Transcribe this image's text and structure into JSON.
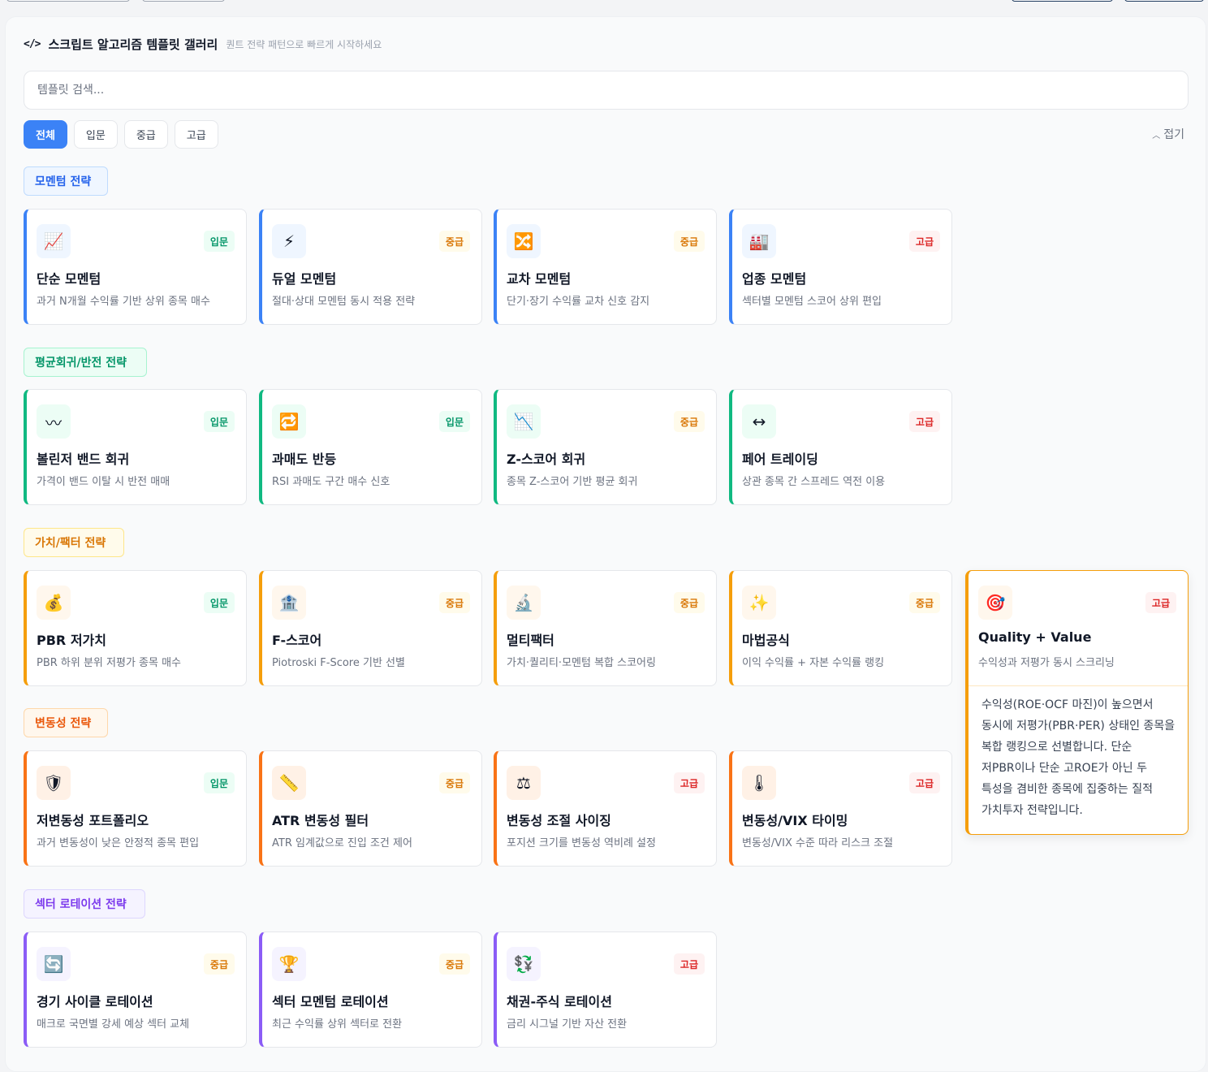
{
  "header": {
    "title": "스크립트 알고리즘 템플릿 갤러리",
    "subtitle": "퀀트 전략 패턴으로 빠르게 시작하세요"
  },
  "search": {
    "placeholder": "템플릿 검색..."
  },
  "filters": [
    "전체",
    "입문",
    "중급",
    "고급"
  ],
  "collapse_label": "접기",
  "colors": {
    "momentum": "#3b82f6",
    "mean_reversion": "#10b981",
    "value": "#f59e0b",
    "volatility": "#f97316",
    "sector": "#8b5cf6"
  },
  "sections": [
    {
      "title": "모멘텀 전략",
      "cards": [
        {
          "icon": "chart-up-icon",
          "emoji": "📈",
          "level": "입문",
          "name": "단순 모멘텀",
          "desc": "과거 N개월 수익률 기반 상위 종목 매수"
        },
        {
          "icon": "lightning-icon",
          "emoji": "⚡",
          "level": "중급",
          "name": "듀얼 모멘텀",
          "desc": "절대·상대 모멘텀 동시 적용 전략"
        },
        {
          "icon": "shuffle-icon",
          "emoji": "🔀",
          "level": "중급",
          "name": "교차 모멘텀",
          "desc": "단기·장기 수익률 교차 신호 감지"
        },
        {
          "icon": "factory-icon",
          "emoji": "🏭",
          "level": "고급",
          "name": "업종 모멘텀",
          "desc": "섹터별 모멘텀 스코어 상위 편입"
        }
      ]
    },
    {
      "title": "평균회귀/반전 전략",
      "cards": [
        {
          "icon": "wave-icon",
          "emoji": "〰",
          "level": "입문",
          "name": "볼린저 밴드 회귀",
          "desc": "가격이 밴드 이탈 시 반전 매매"
        },
        {
          "icon": "repeat-icon",
          "emoji": "🔁",
          "level": "입문",
          "name": "과매도 반등",
          "desc": "RSI 과매도 구간 매수 신호"
        },
        {
          "icon": "chart-down-icon",
          "emoji": "📉",
          "level": "중급",
          "name": "Z-스코어 회귀",
          "desc": "종목 Z-스코어 기반 평균 회귀"
        },
        {
          "icon": "left-right-arrow-icon",
          "emoji": "↔",
          "level": "고급",
          "name": "페어 트레이딩",
          "desc": "상관 종목 간 스프레드 역전 이용"
        }
      ]
    },
    {
      "title": "가치/팩터 전략",
      "cards": [
        {
          "icon": "money-bag-icon",
          "emoji": "💰",
          "level": "입문",
          "name": "PBR 저가치",
          "desc": "PBR 하위 분위 저평가 종목 매수"
        },
        {
          "icon": "bank-icon",
          "emoji": "🏦",
          "level": "중급",
          "name": "F-스코어",
          "desc": "Piotroski F-Score 기반 선별"
        },
        {
          "icon": "microscope-icon",
          "emoji": "🔬",
          "level": "중급",
          "name": "멀티팩터",
          "desc": "가치·퀄리티·모멘텀 복합 스코어링"
        },
        {
          "icon": "sparkles-icon",
          "emoji": "✨",
          "level": "중급",
          "name": "마법공식",
          "desc": "이익 수익률 + 자본 수익률 랭킹"
        }
      ]
    },
    {
      "title": "변동성 전략",
      "cards": [
        {
          "icon": "shield-icon",
          "emoji": "🛡",
          "level": "입문",
          "name": "저변동성 포트폴리오",
          "desc": "과거 변동성이 낮은 안정적 종목 편입"
        },
        {
          "icon": "ruler-icon",
          "emoji": "📏",
          "level": "중급",
          "name": "ATR 변동성 필터",
          "desc": "ATR 임계값으로 진입 조건 제어"
        },
        {
          "icon": "scales-icon",
          "emoji": "⚖",
          "level": "고급",
          "name": "변동성 조절 사이징",
          "desc": "포지션 크기를 변동성 역비례 설정"
        },
        {
          "icon": "thermometer-icon",
          "emoji": "🌡",
          "level": "고급",
          "name": "변동성/VIX 타이밍",
          "desc": "변동성/VIX 수준 따라 리스크 조절"
        }
      ]
    },
    {
      "title": "섹터 로테이션 전략",
      "cards": [
        {
          "icon": "cycle-icon",
          "emoji": "🔄",
          "level": "중급",
          "name": "경기 사이클 로테이션",
          "desc": "매크로 국면별 강세 예상 섹터 교체"
        },
        {
          "icon": "trophy-icon",
          "emoji": "🏆",
          "level": "중급",
          "name": "섹터 모멘텀 로테이션",
          "desc": "최근 수익률 상위 섹터로 전환"
        },
        {
          "icon": "currency-exchange-icon",
          "emoji": "💱",
          "level": "고급",
          "name": "채권-주식 로테이션",
          "desc": "금리 시그널 기반 자산 전환"
        }
      ]
    }
  ],
  "expanded_card": {
    "icon": "target-icon",
    "emoji": "🎯",
    "level": "고급",
    "name": "Quality + Value",
    "desc": "수익성과 저평가 동시 스크리닝",
    "detail": "수익성(ROE·OCF 마진)이 높으면서 동시에 저평가(PBR·PER) 상태인 종목을 복합 랭킹으로 선별합니다. 단순 저PBR이나 단순 고ROE가 아닌 두 특성을 겸비한 종목에 집중하는 질적 가치투자 전략입니다."
  }
}
